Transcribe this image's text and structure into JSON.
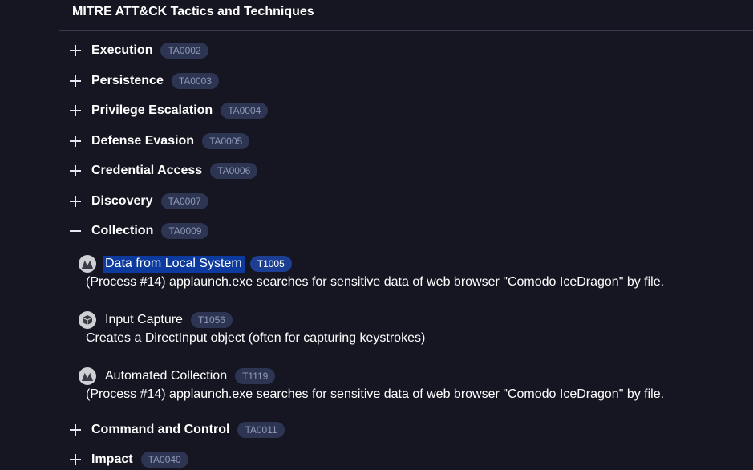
{
  "section_title": "MITRE ATT&CK Tactics and Techniques",
  "tactics": [
    {
      "name": "Execution",
      "id": "TA0002",
      "expanded": false
    },
    {
      "name": "Persistence",
      "id": "TA0003",
      "expanded": false
    },
    {
      "name": "Privilege Escalation",
      "id": "TA0004",
      "expanded": false
    },
    {
      "name": "Defense Evasion",
      "id": "TA0005",
      "expanded": false
    },
    {
      "name": "Credential Access",
      "id": "TA0006",
      "expanded": false
    },
    {
      "name": "Discovery",
      "id": "TA0007",
      "expanded": false
    },
    {
      "name": "Collection",
      "id": "TA0009",
      "expanded": true
    },
    {
      "name": "Command and Control",
      "id": "TA0011",
      "expanded": false
    },
    {
      "name": "Impact",
      "id": "TA0040",
      "expanded": false
    }
  ],
  "techniques": [
    {
      "name": "Data from Local System",
      "id": "T1005",
      "icon": "mitre-logo-icon",
      "selected": true,
      "description": "(Process #14) applaunch.exe searches for sensitive data of web browser \"Comodo IceDragon\" by file."
    },
    {
      "name": "Input Capture",
      "id": "T1056",
      "icon": "cube-icon",
      "selected": false,
      "description": "Creates a DirectInput object (often for capturing keystrokes)"
    },
    {
      "name": "Automated Collection",
      "id": "T1119",
      "icon": "mitre-logo-icon",
      "selected": false,
      "description": "(Process #14) applaunch.exe searches for sensitive data of web browser \"Comodo IceDragon\" by file."
    }
  ],
  "colors": {
    "background": "#161622",
    "badge_bg": "#2d3552",
    "badge_text": "#8f9ab8",
    "selection": "#0c3a9e"
  }
}
